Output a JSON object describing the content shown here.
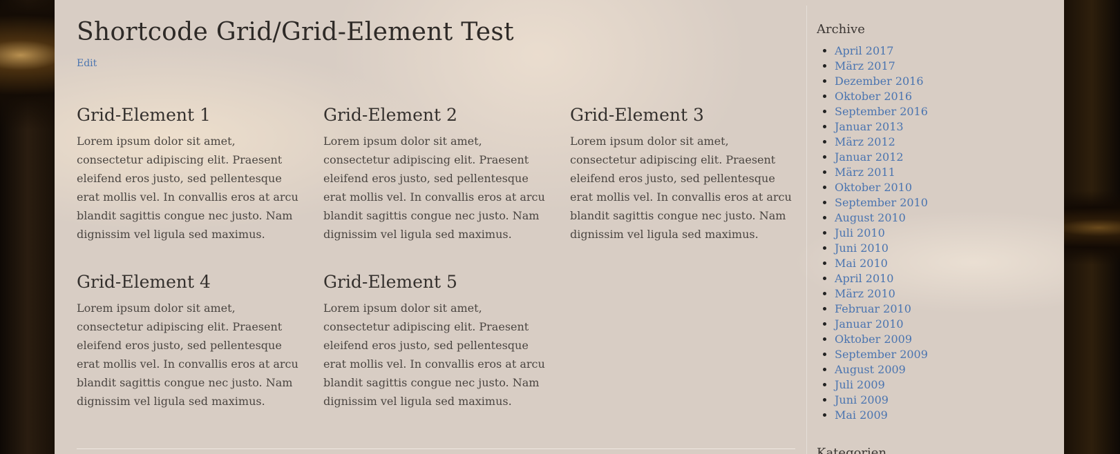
{
  "page": {
    "title": "Shortcode Grid/Grid-Element Test",
    "edit_label": "Edit"
  },
  "grid": [
    {
      "title": "Grid-Element 1",
      "text": "Lorem ipsum dolor sit amet, consectetur adipiscing elit. Praesent eleifend eros justo, sed pellentesque erat mollis vel. In convallis eros at arcu blandit sagittis congue nec justo. Nam dignissim vel ligula sed maximus."
    },
    {
      "title": "Grid-Element 2",
      "text": "Lorem ipsum dolor sit amet, consectetur adipiscing elit. Praesent eleifend eros justo, sed pellentesque erat mollis vel. In convallis eros at arcu blandit sagittis congue nec justo. Nam dignissim vel ligula sed maximus."
    },
    {
      "title": "Grid-Element 3",
      "text": "Lorem ipsum dolor sit amet, consectetur adipiscing elit. Praesent eleifend eros justo, sed pellentesque erat mollis vel. In convallis eros at arcu blandit sagittis congue nec justo. Nam dignissim vel ligula sed maximus."
    },
    {
      "title": "Grid-Element 4",
      "text": "Lorem ipsum dolor sit amet, consectetur adipiscing elit. Praesent eleifend eros justo, sed pellentesque erat mollis vel. In convallis eros at arcu blandit sagittis congue nec justo. Nam dignissim vel ligula sed maximus."
    },
    {
      "title": "Grid-Element 5",
      "text": "Lorem ipsum dolor sit amet, consectetur adipiscing elit. Praesent eleifend eros justo, sed pellentesque erat mollis vel. In convallis eros at arcu blandit sagittis congue nec justo. Nam dignissim vel ligula sed maximus."
    }
  ],
  "sidebar": {
    "archive_title": "Archive",
    "archive_items": [
      "April 2017",
      "März 2017",
      "Dezember 2016",
      "Oktober 2016",
      "September 2016",
      "Januar 2013",
      "März 2012",
      "Januar 2012",
      "März 2011",
      "Oktober 2010",
      "September 2010",
      "August 2010",
      "Juli 2010",
      "Juni 2010",
      "Mai 2010",
      "April 2010",
      "März 2010",
      "Februar 2010",
      "Januar 2010",
      "Oktober 2009",
      "September 2009",
      "August 2009",
      "Juli 2009",
      "Juni 2009",
      "Mai 2009"
    ],
    "next_widget_title": "Kategorien"
  },
  "colors": {
    "link": "#4a74b0",
    "heading": "#2e2a27",
    "body_text": "#4a4541",
    "panel": "#d8cdc4"
  }
}
